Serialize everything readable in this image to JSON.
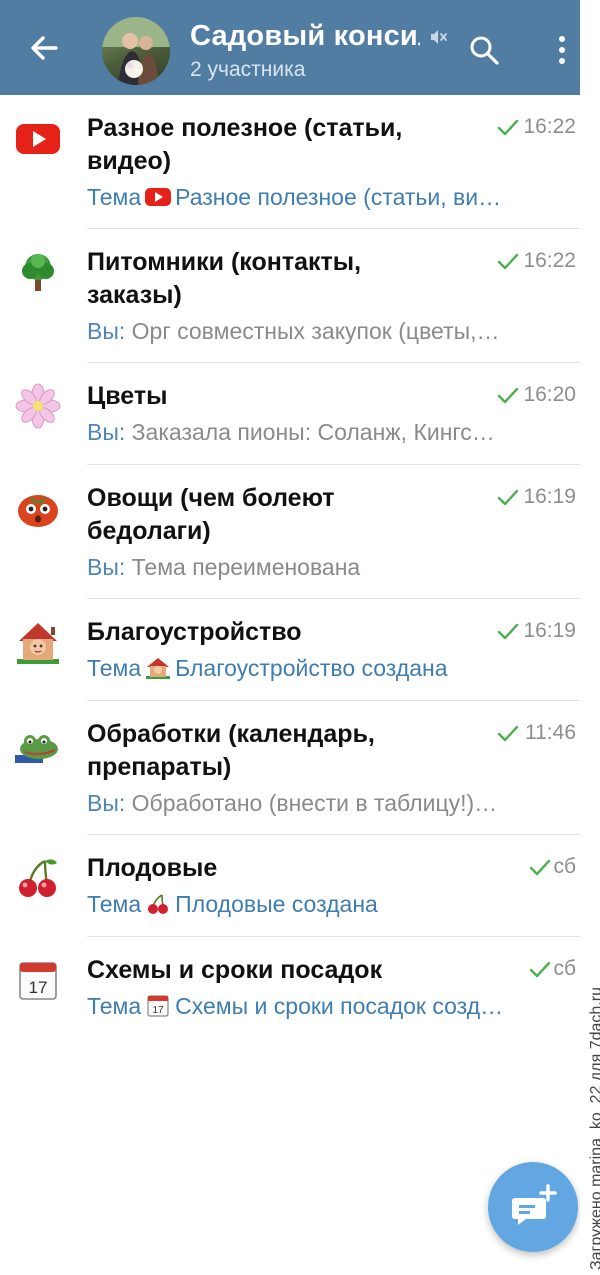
{
  "header": {
    "title": "Садовый консил",
    "subtitle": "2 участника",
    "back_icon": "arrow-left-icon",
    "muted_icon": "muted-speaker-icon",
    "search_icon": "search-icon",
    "more_icon": "more-vertical-icon",
    "background_color": "#517da2"
  },
  "topics": [
    {
      "title": "Разное полезное (статьи, видео)",
      "time": "16:22",
      "icon": "youtube-icon",
      "preview_sender": "Тема",
      "preview_text": "Разное полезное (статьи, ви…",
      "preview_icon": "youtube-icon"
    },
    {
      "title": "Питомники (контакты, заказы)",
      "time": "16:22",
      "icon": "tree-icon",
      "preview_sender": "Вы:",
      "preview_text": "Орг совместных закупок (цветы,…"
    },
    {
      "title": "Цветы",
      "time": "16:20",
      "icon": "flower-icon",
      "preview_sender": "Вы:",
      "preview_text": "Заказала пионы: Соланж, Кингс…"
    },
    {
      "title": "Овощи (чем болеют бедолаги)",
      "time": "16:19",
      "icon": "tomato-icon",
      "preview_sender": "Вы:",
      "preview_text": "Тема переименована"
    },
    {
      "title": "Благоустройство",
      "time": "16:19",
      "icon": "house-icon",
      "preview_sender": "Тема",
      "preview_text": "Благоустройство создана",
      "preview_icon": "house-icon"
    },
    {
      "title": "Обработки (календарь, препараты)",
      "time": "11:46",
      "icon": "frog-icon",
      "preview_sender": "Вы:",
      "preview_text": "Обработано (внести в таблицу!)…"
    },
    {
      "title": "Плодовые",
      "time": "сб",
      "icon": "cherries-icon",
      "preview_sender": "Тема",
      "preview_text": "Плодовые создана",
      "preview_icon": "cherries-icon"
    },
    {
      "title": "Схемы и сроки посадок",
      "time": "сб",
      "icon": "calendar-icon",
      "preview_sender": "Тема",
      "preview_text": "Схемы и сроки посадок созд…",
      "preview_icon": "calendar-icon"
    }
  ],
  "fab": {
    "icon": "new-topic-icon",
    "color": "#62a7e1"
  },
  "watermark": "Загружено marina_ko_22 для 7dach.ru",
  "colors": {
    "read_check": "#4caf50",
    "link_blue": "#3e7db1"
  }
}
